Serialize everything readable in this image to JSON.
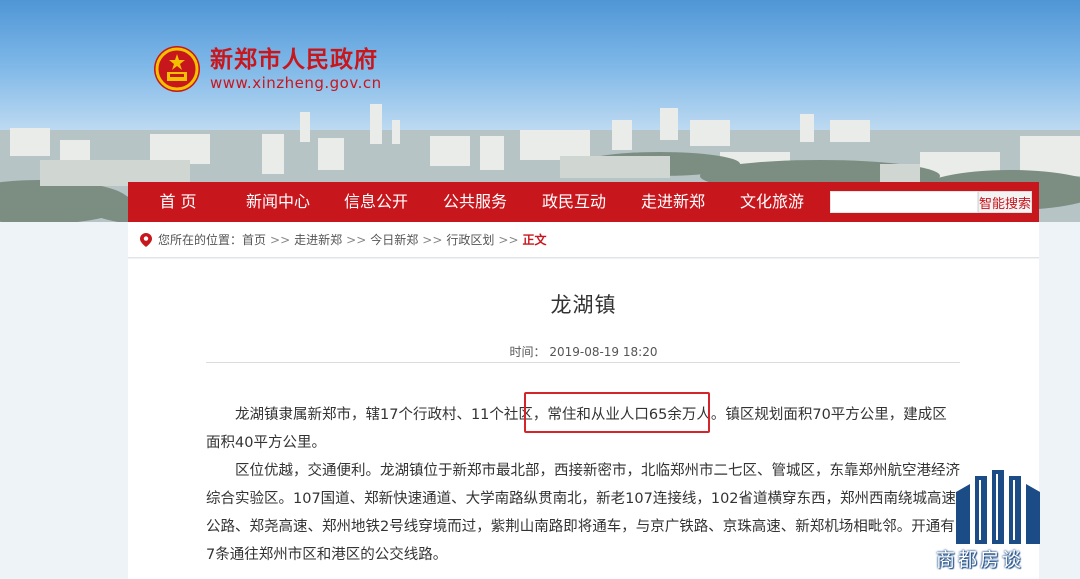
{
  "header": {
    "site_name": "新郑市人民政府",
    "site_url": "www.xinzheng.gov.cn"
  },
  "nav": {
    "items": [
      "首 页",
      "新闻中心",
      "信息公开",
      "公共服务",
      "政民互动",
      "走进新郑",
      "文化旅游"
    ],
    "search_placeholder": "",
    "search_button": "智能搜索"
  },
  "breadcrumb": {
    "label": "您所在的位置：",
    "items": [
      "首页",
      "走进新郑",
      "今日新郑",
      "行政区划"
    ],
    "separator": ">>",
    "current": "正文"
  },
  "article": {
    "title": "龙湖镇",
    "time": "时间： 2019-08-19 18:20",
    "paragraphs": [
      "龙湖镇隶属新郑市，辖17个行政村、11个社区，常住和从业人口65余万人。镇区规划面积70平方公里，建成区面积40平方公里。",
      "区位优越，交通便利。龙湖镇位于新郑市最北部，西接新密市，北临郑州市二七区、管城区，东靠郑州航空港经济综合实验区。107国道、郑新快速通道、大学南路纵贯南北，新老107连接线，102省道横穿东西，郑州西南绕城高速公路、郑尧高速、郑州地铁2号线穿境而过，紫荆山南路即将通车，与京广铁路、京珠高速、新郑机场相毗邻。开通有7条通往郑州市区和港区的公交线路。"
    ]
  },
  "watermark": {
    "text": "商都房谈"
  },
  "colors": {
    "brand_red": "#c8161d",
    "highlight_border": "#d4252b",
    "watermark_blue": "#1c4c86"
  }
}
